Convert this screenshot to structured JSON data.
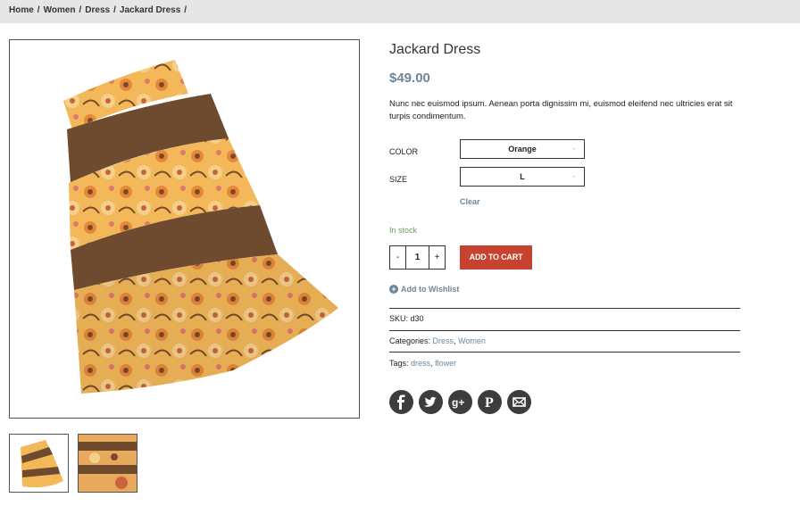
{
  "breadcrumb": {
    "home": "Home",
    "women": "Women",
    "dress": "Dress",
    "current": "Jackard Dress",
    "separator": "/"
  },
  "product": {
    "title": "Jackard Dress",
    "price": "$49.00",
    "description": "Nunc nec euismod ipsum. Aenean porta dignissim mi, euismod eleifend nec ultricies erat sit turpis condimentum.",
    "color_label": "COLOR",
    "color_value": "Orange",
    "size_label": "SIZE",
    "size_value": "L",
    "clear_label": "Clear",
    "stock": "In stock",
    "qty_minus": "-",
    "qty_value": "1",
    "qty_plus": "+",
    "add_to_cart": "ADD TO CART",
    "wishlist": "Add to Wishlist",
    "sku_label": "SKU:",
    "sku_value": "d30",
    "categories_label": "Categories:",
    "categories": [
      "Dress",
      "Women"
    ],
    "tags_label": "Tags:",
    "tags": [
      "dress",
      "flower"
    ]
  },
  "share_icons": [
    "facebook-icon",
    "twitter-icon",
    "google-plus-icon",
    "pinterest-icon",
    "email-icon"
  ],
  "colors": {
    "price": "#6d8798",
    "add_to_cart": "#c8432f",
    "in_stock": "#6aa160",
    "breadcrumb_bg": "#e6e6e6",
    "icon": "#3d3d3d"
  }
}
